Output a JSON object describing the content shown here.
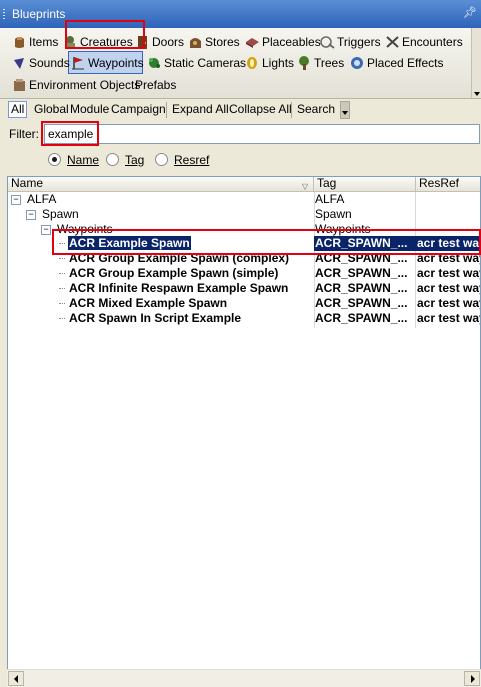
{
  "window": {
    "title": "Blueprints"
  },
  "categories": [
    {
      "label": "Items",
      "icon": "items-icon",
      "color": "#8a5a2b"
    },
    {
      "label": "Creatures",
      "icon": "creatures-icon",
      "color": "#5b6e3a"
    },
    {
      "label": "Doors",
      "icon": "doors-icon",
      "color": "#6b3f1e"
    },
    {
      "label": "Stores",
      "icon": "stores-icon",
      "color": "#7a5230"
    },
    {
      "label": "Placeables",
      "icon": "placeables-icon",
      "color": "#9c4a4a"
    },
    {
      "label": "Triggers",
      "icon": "triggers-icon",
      "color": "#6a6a6a"
    },
    {
      "label": "Encounters",
      "icon": "encounters-icon",
      "color": "#444444"
    },
    {
      "label": "Sounds",
      "icon": "sounds-icon",
      "color": "#3a3a8a"
    },
    {
      "label": "Waypoints",
      "icon": "waypoints-icon",
      "color": "#b02020"
    },
    {
      "label": "Static Cameras",
      "icon": "static-cameras-icon",
      "color": "#2e7d32"
    },
    {
      "label": "Lights",
      "icon": "lights-icon",
      "color": "#d4a017"
    },
    {
      "label": "Trees",
      "icon": "trees-icon",
      "color": "#4a7a2a"
    },
    {
      "label": "Placed Effects",
      "icon": "placed-effects-icon",
      "color": "#3a6ab0"
    },
    {
      "label": "Environment Objects",
      "icon": "environment-objects-icon",
      "color": "#8a6a4a"
    },
    {
      "label": "Prefabs",
      "icon": "",
      "color": ""
    }
  ],
  "toolbar": {
    "all": "All",
    "global": "Global",
    "module": "Module",
    "campaign": "Campaign",
    "expand_all": "Expand All",
    "collapse_all": "Collapse All",
    "search": "Search"
  },
  "filter": {
    "label": "Filter:",
    "value": "example"
  },
  "search_by": {
    "options": [
      "Name",
      "Tag",
      "Resref"
    ],
    "selected": "Name"
  },
  "tree": {
    "columns": [
      "Name",
      "Tag",
      "ResRef"
    ],
    "rows": [
      {
        "name": "ALFA",
        "tag": "ALFA",
        "resref": "",
        "level": 0,
        "expandable": true
      },
      {
        "name": "Spawn",
        "tag": "Spawn",
        "resref": "",
        "level": 1,
        "expandable": true
      },
      {
        "name": "Waypoints",
        "tag": "Waypoints",
        "resref": "",
        "level": 2,
        "expandable": true
      },
      {
        "name": "ACR Example Spawn",
        "tag": "ACR_SPAWN_...",
        "resref": "acr test way",
        "level": 3,
        "selected": true
      },
      {
        "name": "ACR Group Example Spawn (complex)",
        "tag": "ACR_SPAWN_...",
        "resref": "acr test way",
        "level": 3
      },
      {
        "name": "ACR Group Example Spawn (simple)",
        "tag": "ACR_SPAWN_...",
        "resref": "acr test way",
        "level": 3
      },
      {
        "name": "ACR Infinite Respawn Example Spawn",
        "tag": "ACR_SPAWN_...",
        "resref": "acr test way",
        "level": 3
      },
      {
        "name": "ACR Mixed Example Spawn",
        "tag": "ACR_SPAWN_...",
        "resref": "acr test way",
        "level": 3
      },
      {
        "name": "ACR Spawn In Script Example",
        "tag": "ACR_SPAWN_...",
        "resref": "acr test way",
        "level": 3
      }
    ]
  },
  "colors": {
    "title_bar": "#2f63b8",
    "selection": "#0a246a",
    "highlight": "#e3000f"
  }
}
